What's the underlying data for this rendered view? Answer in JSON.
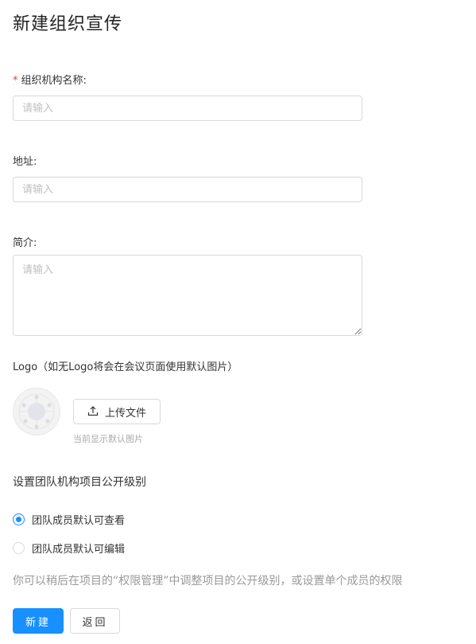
{
  "page": {
    "title": "新建组织宣传"
  },
  "form": {
    "org_name": {
      "required_mark": "*",
      "label": "组织机构名称:",
      "placeholder": "请输入"
    },
    "address": {
      "label": "地址:",
      "placeholder": "请输入"
    },
    "intro": {
      "label": "简介:",
      "placeholder": "请输入"
    },
    "logo": {
      "label": "Logo（如无Logo将会在会议页面使用默认图片）",
      "upload_label": "上传文件",
      "upload_icon": "upload-icon",
      "hint": "当前显示默认图片",
      "placeholder_icon": "default-image-icon"
    }
  },
  "visibility": {
    "title": "设置团队机构项目公开级别",
    "options": [
      {
        "label": "团队成员默认可查看",
        "checked": true
      },
      {
        "label": "团队成员默认可编辑",
        "checked": false
      }
    ],
    "note": "你可以稍后在项目的“权限管理”中调整项目的公开级别，或设置单个成员的权限"
  },
  "actions": {
    "create_label": "新建",
    "back_label": "返回"
  },
  "colors": {
    "primary": "#1890ff",
    "required": "#e53935",
    "placeholder": "#bfbfbf",
    "border": "#d9d9d9"
  }
}
